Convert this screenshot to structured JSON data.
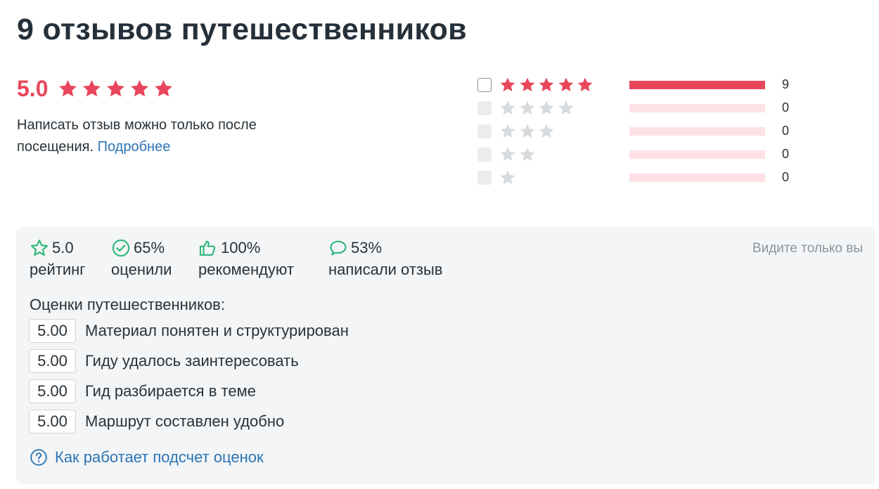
{
  "header": {
    "title": "9 отзывов путешественников"
  },
  "summary": {
    "average": "5.0",
    "average_stars": 5,
    "note": "Написать отзыв можно только после посещения.",
    "more_link": "Подробнее"
  },
  "breakdown": [
    {
      "stars": 5,
      "count": "9",
      "fraction": 1.0
    },
    {
      "stars": 4,
      "count": "0",
      "fraction": 0
    },
    {
      "stars": 3,
      "count": "0",
      "fraction": 0
    },
    {
      "stars": 2,
      "count": "0",
      "fraction": 0
    },
    {
      "stars": 1,
      "count": "0",
      "fraction": 0
    }
  ],
  "stats": {
    "rating": {
      "value": "5.0",
      "label": "рейтинг",
      "icon": "star-outline-icon"
    },
    "rated": {
      "value": "65%",
      "label": "оценили",
      "icon": "check-circle-icon"
    },
    "recommend": {
      "value": "100%",
      "label": "рекомендуют",
      "icon": "thumbs-up-icon"
    },
    "wrote": {
      "value": "53%",
      "label": "написали отзыв",
      "icon": "speech-bubble-icon"
    },
    "only_you": "Видите только вы"
  },
  "criteria": {
    "title": "Оценки путешественников:",
    "items": [
      {
        "score": "5.00",
        "label": "Материал понятен и структурирован"
      },
      {
        "score": "5.00",
        "label": "Гиду удалось заинтересовать"
      },
      {
        "score": "5.00",
        "label": "Гид разбирается в теме"
      },
      {
        "score": "5.00",
        "label": "Маршрут составлен удобно"
      }
    ]
  },
  "help": {
    "label": "Как работает подсчет оценок",
    "icon": "question-circle-icon"
  },
  "colors": {
    "accent_red": "#e8475b",
    "bar_empty": "#fde1e5",
    "star_grey": "#d7dbde",
    "link_blue": "#2b74b5",
    "icon_green": "#2fb57a",
    "panel_bg": "#f3f5f6"
  }
}
